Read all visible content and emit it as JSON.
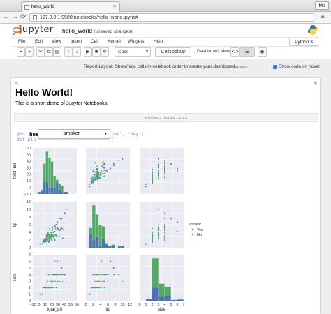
{
  "browser": {
    "tab_title": "hello_world",
    "tab_close": "×",
    "profile": "Me",
    "url": "127.0.0.1:9500/notebooks/hello_world.ipynb#",
    "back": "←",
    "forward": "→",
    "reload": "⟳",
    "menu": "≡"
  },
  "jupyter": {
    "logo_text": "jupyter",
    "notebook_name": "hello_world",
    "save_status": "(unsaved changes)",
    "kernel": "Python 3",
    "menu": [
      "File",
      "Edit",
      "View",
      "Insert",
      "Cell",
      "Kernel",
      "Widgets",
      "Help"
    ],
    "toolbar": {
      "save": "▪",
      "insert": "+",
      "cut": "✂",
      "copy": "⧉",
      "paste": "▤",
      "move_up": "↑",
      "move_down": "↓",
      "run": "▶",
      "stop": "■",
      "restart": "↻",
      "cell_type": "Code",
      "celltoolbar": "CellToolbar",
      "dashboard_label": "Dashboard View:",
      "dv_code": "</>",
      "dv_grid": "▦",
      "dv_report": "☰",
      "dv_preview": "◉"
    },
    "report_text": "Report Layout: Show/hide cells in notebook order to create your dashboard.",
    "more_info": "MORE INFO",
    "show_code_label": "Show code on hover",
    "show_code_checked": true,
    "markdown": {
      "heading": "Hello World!",
      "text": "This is a short demo of Jupyter Notebooks."
    },
    "hidden_cells": "EXPAND 4 HIDDEN CELLS",
    "code_fragment_1": "@in",
    "code_fragment_2": "def plo",
    "code_fragment_3": "ime', 'day']",
    "code_fragment_4": "(",
    "widget": {
      "label": "hue",
      "value": "smoker"
    }
  },
  "colors": {
    "accent": "#3b79d8",
    "series_yes": "#4c72b0",
    "series_no": "#55a868",
    "plot_bg": "#eaeaf2"
  },
  "chart_data": {
    "type": "scatter",
    "variables": [
      "total_bill",
      "tip",
      "size"
    ],
    "axis_labels": {
      "total_bill": "total_bill",
      "tip": "tip",
      "size": "size"
    },
    "ticks": {
      "total_bill_y": [
        "60",
        "50",
        "40",
        "30",
        "20",
        "10",
        "0",
        "−10"
      ],
      "tip_y": [
        "12",
        "10",
        "8",
        "6",
        "4",
        "2",
        "0"
      ],
      "size_y": [
        "7",
        "6",
        "5",
        "4",
        "3",
        "2",
        "1",
        "0"
      ],
      "total_bill_x": [
        "−10",
        "0",
        "10",
        "20",
        "30",
        "40",
        "50",
        "60"
      ],
      "tip_x": [
        "0",
        "2",
        "4",
        "6",
        "8",
        "10",
        "12"
      ],
      "size_x": [
        "0",
        "1",
        "2",
        "3",
        "4",
        "5",
        "6",
        "7"
      ]
    },
    "legend": {
      "title": "smoker",
      "entries": [
        "Yes",
        "No"
      ],
      "position": "right"
    },
    "series": [
      {
        "name": "Yes",
        "color": "#4c72b0"
      },
      {
        "name": "No",
        "color": "#55a868"
      }
    ],
    "points": [
      [
        10.3,
        1.7,
        2
      ],
      [
        21,
        3.5,
        3
      ],
      [
        23.7,
        3.3,
        2
      ],
      [
        25.3,
        4.7,
        4
      ],
      [
        16.3,
        1.7,
        2
      ],
      [
        24.6,
        3.6,
        4
      ],
      [
        35.3,
        5,
        4
      ],
      [
        15,
        2,
        2
      ],
      [
        14.8,
        3.2,
        2
      ],
      [
        10.3,
        1.7,
        2
      ],
      [
        20.3,
        2.8,
        2
      ],
      [
        22,
        3,
        3
      ],
      [
        30.4,
        5.6,
        4
      ],
      [
        18.4,
        3,
        4
      ],
      [
        39.4,
        7.6,
        4
      ],
      [
        15.7,
        3,
        2
      ],
      [
        19.8,
        3.2,
        2
      ],
      [
        28.6,
        4.7,
        3
      ],
      [
        12.5,
        1.5,
        2
      ],
      [
        26.9,
        3.1,
        3
      ],
      [
        40.2,
        4.7,
        4
      ],
      [
        48.3,
        9,
        4
      ],
      [
        13.4,
        2,
        2
      ],
      [
        17.9,
        3.5,
        2
      ],
      [
        9.6,
        1.5,
        2
      ],
      [
        27.2,
        4,
        4
      ],
      [
        22.8,
        2.3,
        3
      ],
      [
        32.4,
        6,
        4
      ],
      [
        16.6,
        3.2,
        3
      ],
      [
        14.3,
        2.5,
        2
      ],
      [
        7.3,
        1,
        1
      ],
      [
        11.9,
        2,
        2
      ],
      [
        20.7,
        3,
        2
      ],
      [
        25.9,
        5.2,
        3
      ],
      [
        44.3,
        2.5,
        3
      ],
      [
        34.8,
        5.2,
        4
      ],
      [
        50.8,
        10,
        3
      ],
      [
        31.3,
        5,
        3
      ],
      [
        12.6,
        1.5,
        2
      ],
      [
        19.1,
        1.5,
        2
      ],
      [
        17.5,
        2.6,
        2
      ],
      [
        24.1,
        2,
        2
      ],
      [
        15.4,
        1.6,
        2
      ],
      [
        29.8,
        4.2,
        6
      ],
      [
        8.5,
        1.5,
        2
      ],
      [
        16.5,
        2,
        2
      ],
      [
        28.2,
        2.5,
        2
      ],
      [
        13,
        2,
        2
      ],
      [
        21.2,
        3,
        2
      ],
      [
        38,
        3,
        4
      ],
      [
        11.6,
        1.5,
        2
      ],
      [
        26.4,
        3.5,
        3
      ],
      [
        19.5,
        1.8,
        2
      ],
      [
        43.1,
        5,
        4
      ],
      [
        18.3,
        3.4,
        2
      ],
      [
        24,
        3,
        3
      ],
      [
        14.5,
        2,
        2
      ],
      [
        33.7,
        3,
        4
      ],
      [
        22.2,
        4,
        2
      ],
      [
        9.8,
        2,
        2
      ],
      [
        30.1,
        2,
        4
      ],
      [
        17.3,
        3.6,
        3
      ],
      [
        20.9,
        5,
        2
      ],
      [
        15.8,
        3.2,
        2
      ],
      [
        25.6,
        4.1,
        2
      ],
      [
        12.9,
        1.8,
        2
      ],
      [
        34.3,
        6.7,
        6
      ],
      [
        27.3,
        4,
        3
      ],
      [
        18.7,
        2.3,
        2
      ],
      [
        41.2,
        5,
        3
      ],
      [
        13.8,
        2,
        2
      ],
      [
        23.3,
        2.6,
        2
      ],
      [
        16,
        2.2,
        2
      ],
      [
        29,
        5.9,
        3
      ],
      [
        21.5,
        3.5,
        2
      ],
      [
        10.6,
        1.6,
        2
      ],
      [
        26.6,
        3.1,
        3
      ],
      [
        17.8,
        3.3,
        2
      ],
      [
        32.8,
        3.2,
        2
      ],
      [
        45.4,
        4.7,
        4
      ],
      [
        14.1,
        2.5,
        2
      ],
      [
        19.9,
        1.9,
        2
      ],
      [
        24.9,
        4.5,
        4
      ],
      [
        11.3,
        1.8,
        2
      ],
      [
        38.7,
        4.5,
        3
      ],
      [
        16.9,
        3.8,
        3
      ],
      [
        22.6,
        3.5,
        2
      ],
      [
        28.9,
        3,
        2
      ],
      [
        13.3,
        2.1,
        2
      ],
      [
        20.1,
        2.5,
        4
      ],
      [
        35.8,
        4.7,
        3
      ],
      [
        18,
        3.9,
        2
      ],
      [
        25,
        3,
        2
      ],
      [
        3.1,
        1,
        1
      ],
      [
        16.3,
        2.6,
        2
      ],
      [
        23.1,
        4,
        3
      ],
      [
        12,
        2,
        2
      ],
      [
        30.5,
        3.3,
        3
      ],
      [
        19.4,
        2,
        2
      ],
      [
        42.5,
        7.6,
        5
      ]
    ]
  }
}
